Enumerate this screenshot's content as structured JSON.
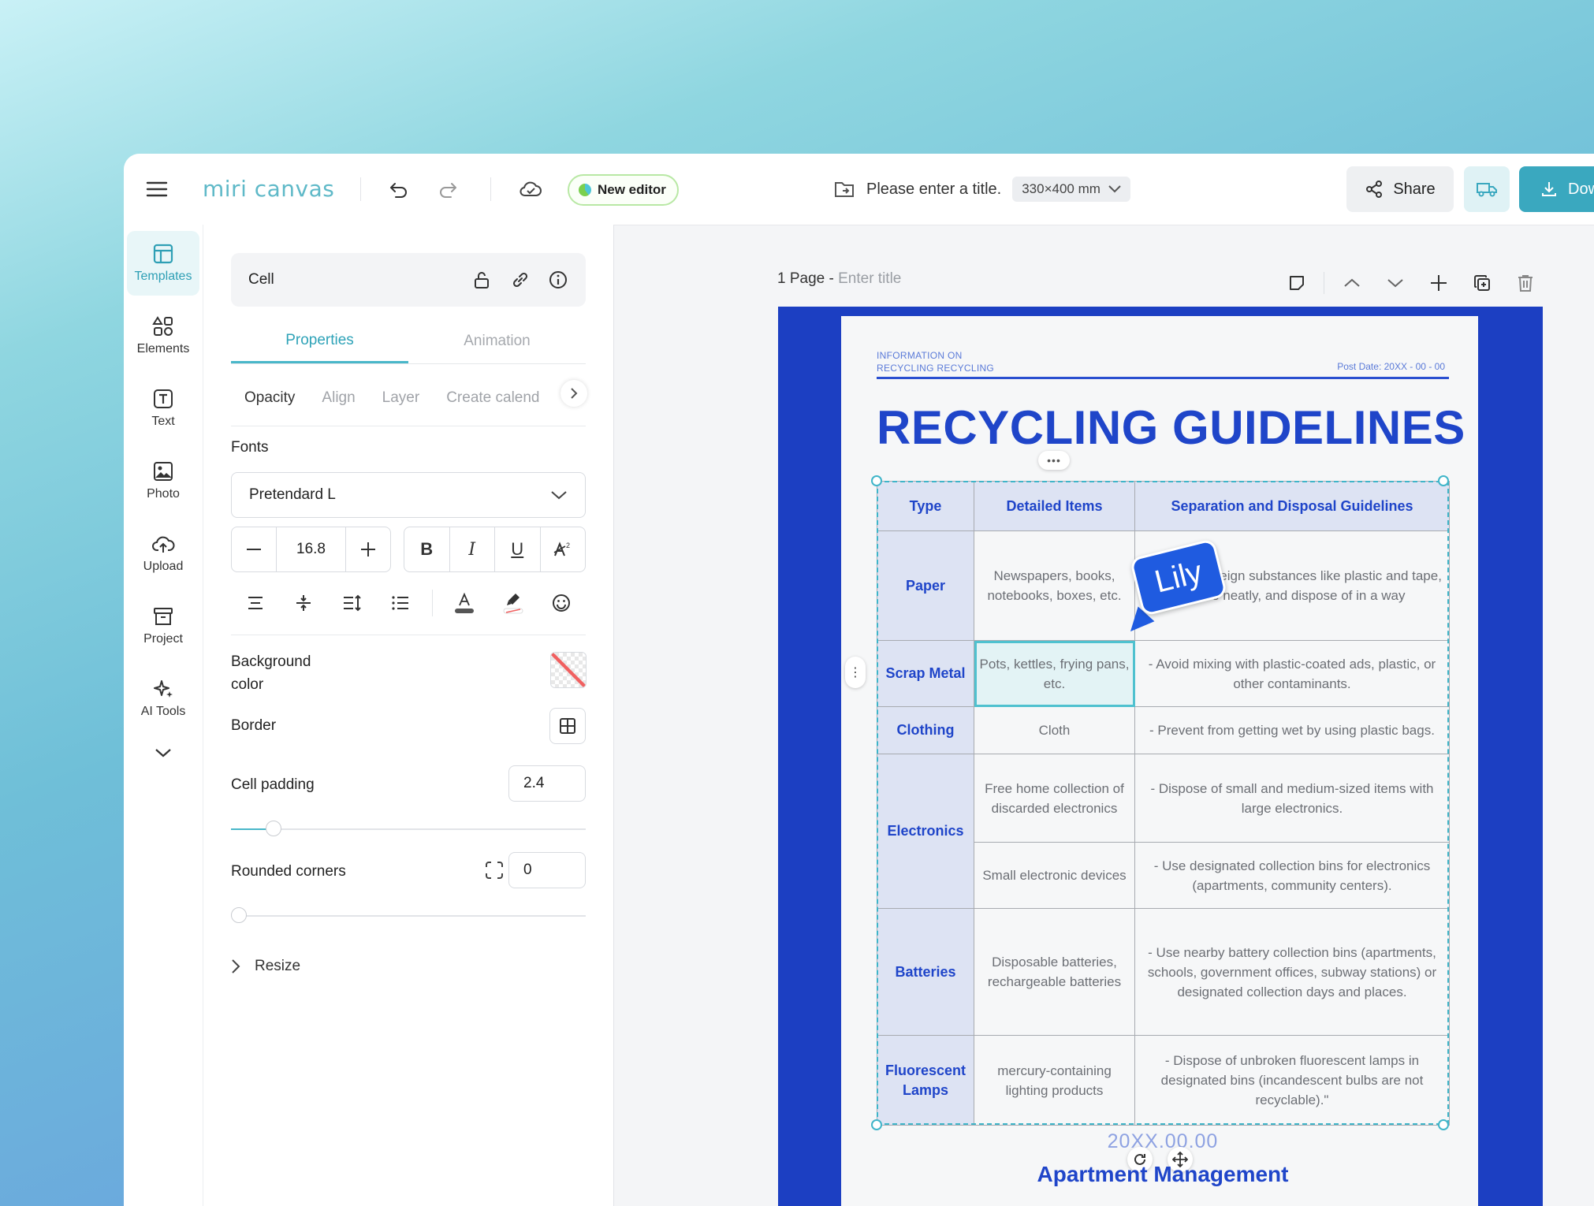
{
  "topbar": {
    "logo": "miri canvas",
    "new_editor": "New editor",
    "title_placeholder": "Please enter a title.",
    "size": "330×400 mm",
    "share": "Share",
    "download": "Dow"
  },
  "rail": {
    "items": [
      {
        "label": "Templates",
        "icon": "template-icon"
      },
      {
        "label": "Elements",
        "icon": "elements-icon"
      },
      {
        "label": "Text",
        "icon": "text-icon"
      },
      {
        "label": "Photo",
        "icon": "photo-icon"
      },
      {
        "label": "Upload",
        "icon": "upload-icon"
      },
      {
        "label": "Project",
        "icon": "project-icon"
      },
      {
        "label": "AI Tools",
        "icon": "sparkle-icon"
      }
    ]
  },
  "panel": {
    "element_name": "Cell",
    "tabs": [
      "Properties",
      "Animation"
    ],
    "subtabs": [
      "Opacity",
      "Align",
      "Layer",
      "Create calend"
    ],
    "fonts_label": "Fonts",
    "font_value": "Pretendard L",
    "font_size": "16.8",
    "bg_label": "Background\ncolor",
    "border_label": "Border",
    "cell_padding_label": "Cell padding",
    "cell_padding_value": "2.4",
    "cell_padding_fraction": 0.12,
    "rounded_label": "Rounded corners",
    "rounded_value": "0",
    "rounded_fraction": 0.0,
    "resize_label": "Resize"
  },
  "page": {
    "label": "1 Page -",
    "title_placeholder": "Enter title"
  },
  "doc": {
    "head_left_1": "INFORMATION ON",
    "head_left_2": "RECYCLING RECYCLING",
    "head_right": "Post Date: 20XX - 00 - 00",
    "title": "RECYCLING GUIDELINES",
    "columns": [
      "Type",
      "Detailed Items",
      "Separation and Disposal Guidelines"
    ],
    "rows": {
      "paper": {
        "type": "Paper",
        "items": "Newspapers, books, notebooks, boxes, etc.",
        "guide": "- Remove foreign substances like plastic and tape, bundle neatly, and dispose of in a way"
      },
      "scrap": {
        "type": "Scrap Metal",
        "items": "Pots, kettles, frying pans, etc.",
        "guide": "- Avoid mixing with plastic-coated ads, plastic, or other contaminants."
      },
      "clothing": {
        "type": "Clothing",
        "items": "Cloth",
        "guide": "- Prevent from getting wet by using plastic bags."
      },
      "electronics": {
        "type": "Electronics",
        "items_a": "Free home collection of discarded electronics",
        "guide_a": "- Dispose of small and medium-sized items with large electronics.",
        "items_b": "Small electronic devices",
        "guide_b": "- Use designated collection bins for electronics (apartments, community centers)."
      },
      "batteries": {
        "type": "Batteries",
        "items": "Disposable batteries, rechargeable batteries",
        "guide": "- Use nearby battery collection bins (apartments, schools, government offices, subway stations) or designated collection days and places."
      },
      "fluorescent": {
        "type": "Fluorescent Lamps",
        "items": "mercury-containing lighting products",
        "guide": "- Dispose of unbroken fluorescent lamps in designated bins (incandescent bulbs are not recyclable).\""
      }
    },
    "date": "20XX.00.00",
    "footer": "Apartment Management"
  },
  "cursor_label": "Lily",
  "colors": {
    "accent": "#3aa8bf",
    "doc_blue": "#1f45c9",
    "page_blue": "#1c3fc2"
  }
}
